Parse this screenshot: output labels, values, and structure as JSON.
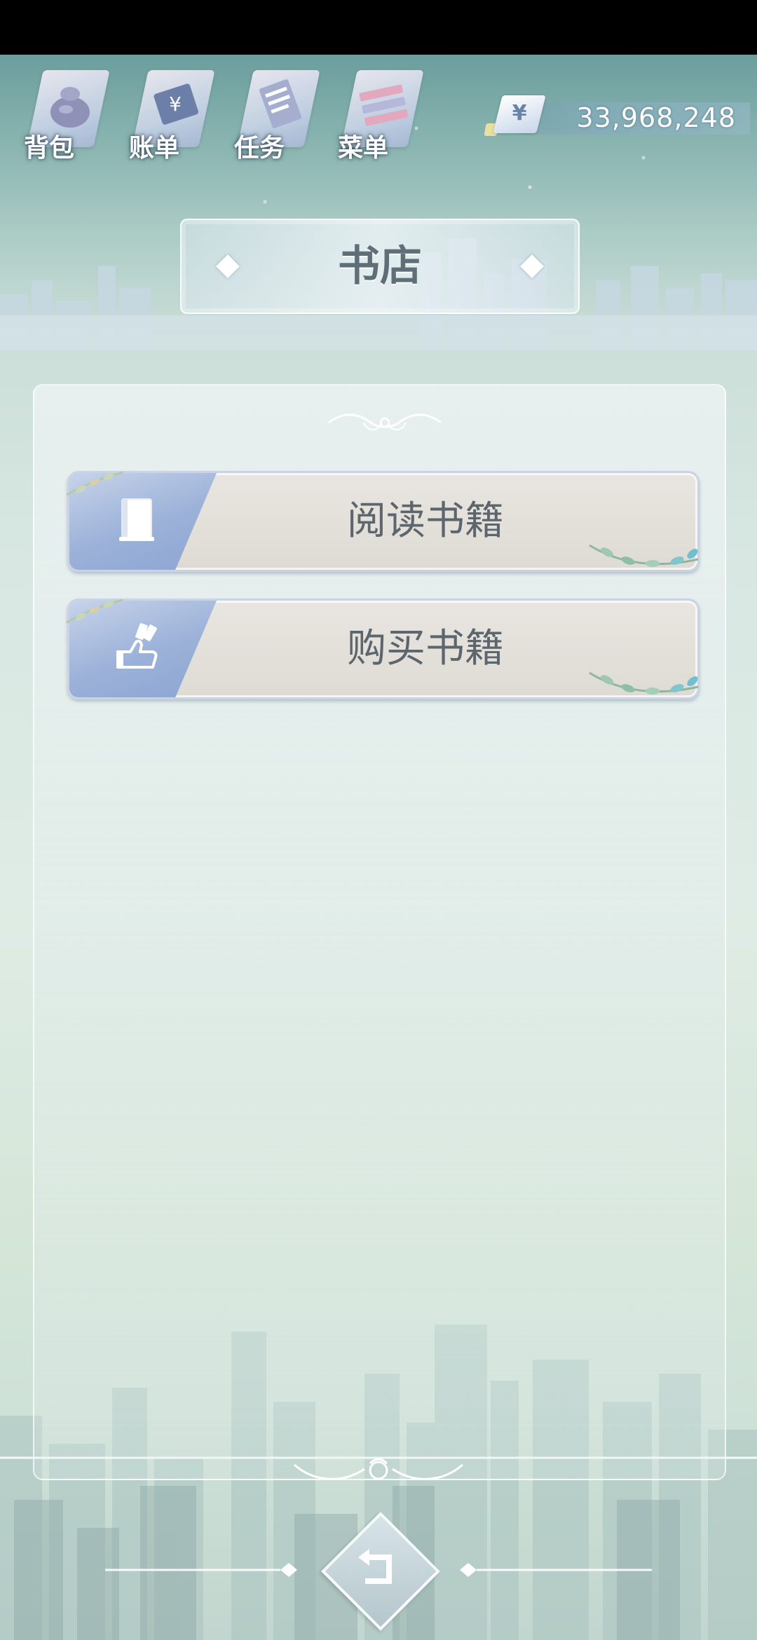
{
  "top_nav": [
    {
      "id": "bag",
      "label": "背包",
      "icon": "bag-icon"
    },
    {
      "id": "bill",
      "label": "账单",
      "icon": "bill-icon"
    },
    {
      "id": "task",
      "label": "任务",
      "icon": "task-icon"
    },
    {
      "id": "menu",
      "label": "菜单",
      "icon": "menu-icon"
    }
  ],
  "currency": {
    "symbol": "¥",
    "value": "33,968,248"
  },
  "title": "书店",
  "actions": [
    {
      "label": "阅读书籍",
      "icon": "book-icon"
    },
    {
      "label": "购买书籍",
      "icon": "buy-hand-icon"
    }
  ],
  "colors": {
    "accent_blue": "#9bb1d8",
    "button_face": "#e4e1dc",
    "label_text": "#5c666c",
    "background": "#d8e7e2"
  }
}
